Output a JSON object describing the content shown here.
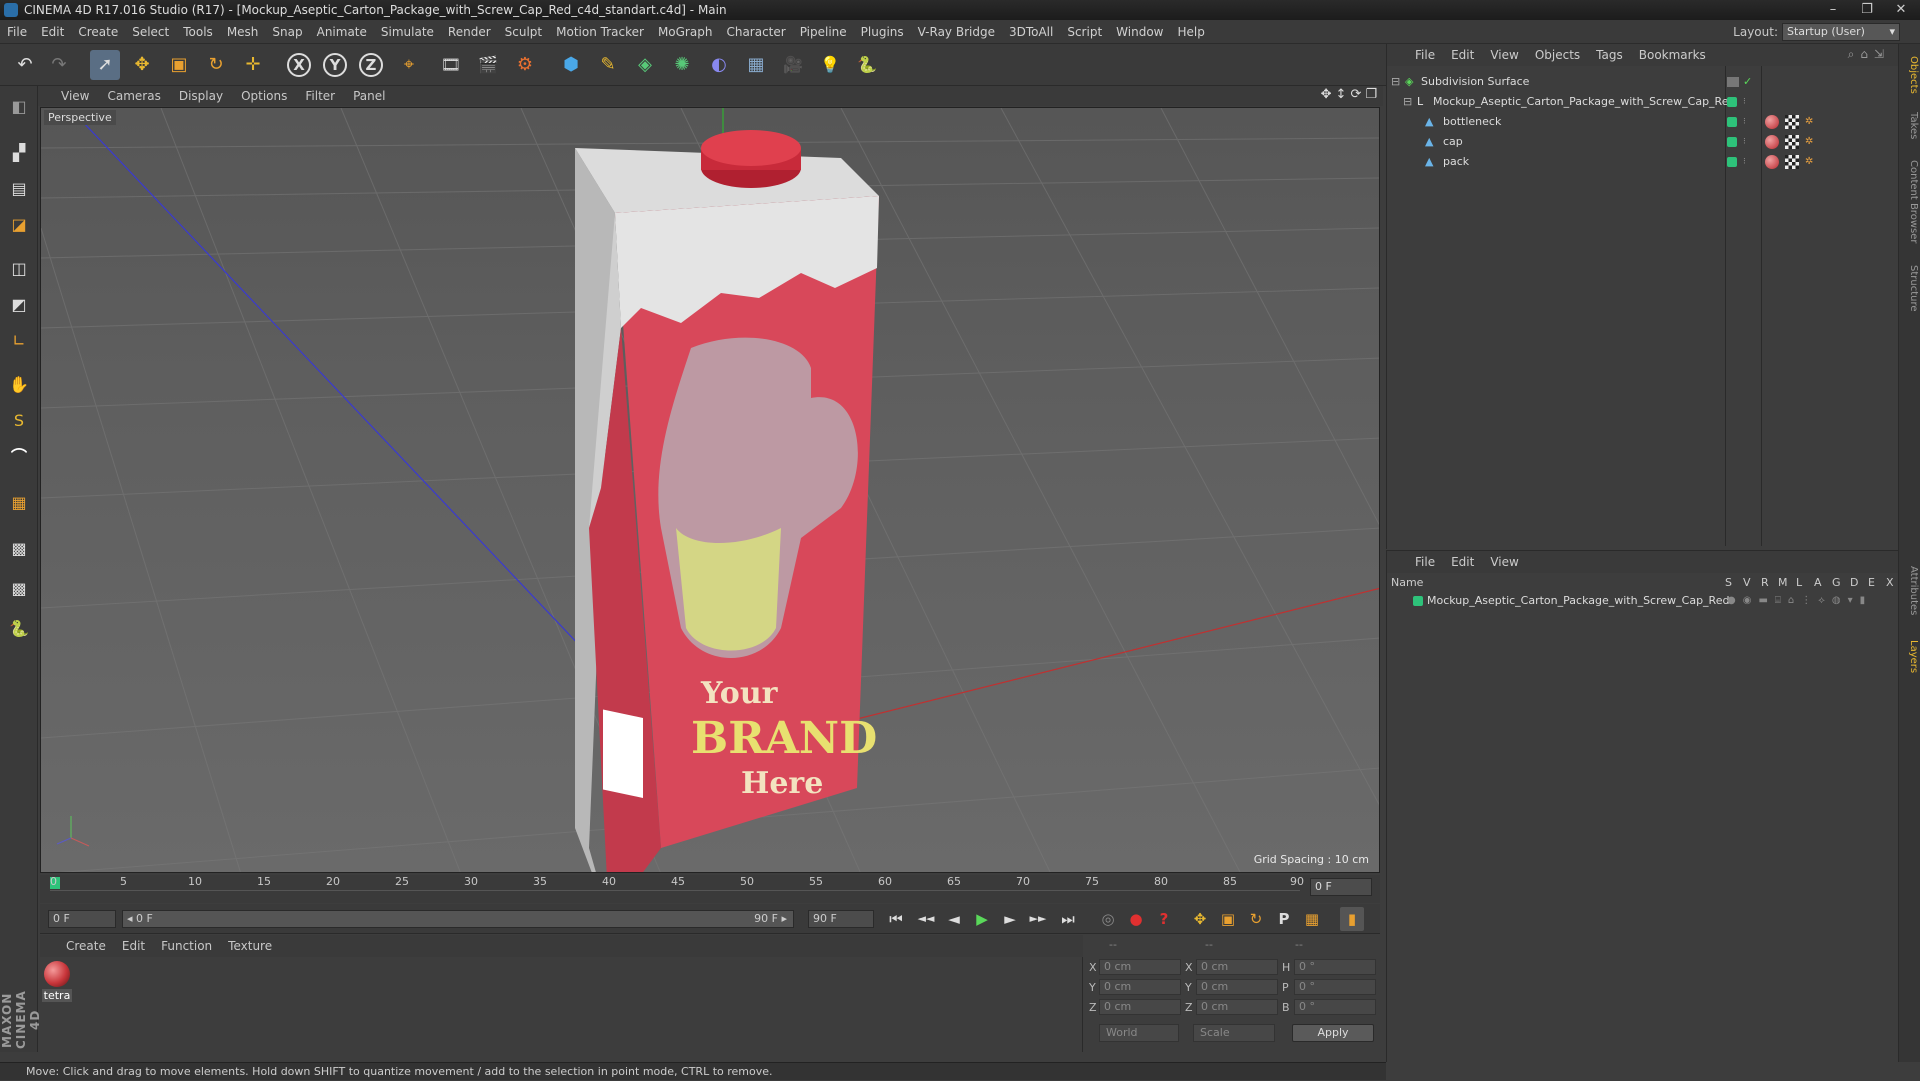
{
  "window": {
    "title": "CINEMA 4D R17.016 Studio (R17) - [Mockup_Aseptic_Carton_Package_with_Screw_Cap_Red_c4d_standart.c4d] - Main",
    "controls": [
      "–",
      "❐",
      "✕"
    ]
  },
  "menubar": {
    "items": [
      "File",
      "Edit",
      "Create",
      "Select",
      "Tools",
      "Mesh",
      "Snap",
      "Animate",
      "Simulate",
      "Render",
      "Sculpt",
      "Motion Tracker",
      "MoGraph",
      "Character",
      "Pipeline",
      "Plugins",
      "V-Ray Bridge",
      "3DToAll",
      "Script",
      "Window",
      "Help"
    ],
    "layout_label": "Layout:",
    "layout_value": "Startup (User)"
  },
  "toolbar": {
    "undo": "↶",
    "redo": "↷",
    "select": "➚",
    "move": "✥",
    "scale": "▣",
    "rotate": "↻",
    "last": "✛",
    "axis_x": "X",
    "axis_y": "Y",
    "axis_z": "Z",
    "coord": "⌖",
    "render_view": "🎞",
    "render_pic": "🎬",
    "render_settings": "⚙",
    "cube": "⬢",
    "pen": "✎",
    "subdiv": "◈",
    "cloner": "✺",
    "deformer": "◐",
    "floor": "▦",
    "camera": "🎥",
    "light": "💡",
    "python": "🐍"
  },
  "lefttools": [
    "◧",
    "▞",
    "▤",
    "◪",
    "◫",
    "◩",
    "∟",
    "✋",
    "S",
    "⌒",
    "▦",
    "▩",
    "🐍"
  ],
  "brand": "MAXON CINEMA 4D",
  "viewport": {
    "menu": [
      "View",
      "Cameras",
      "Display",
      "Options",
      "Filter",
      "Panel"
    ],
    "nav": "✥↕⟳❐",
    "label": "Perspective",
    "grid_spacing": "Grid Spacing : 10 cm",
    "pack_text": {
      "line1": "Your",
      "line2": "BRAND",
      "line3": "Here"
    }
  },
  "timeline": {
    "ticks": [
      "0",
      "5",
      "10",
      "15",
      "20",
      "25",
      "30",
      "35",
      "40",
      "45",
      "50",
      "55",
      "60",
      "65",
      "70",
      "75",
      "80",
      "85",
      "90"
    ],
    "end_frame": "0 F"
  },
  "transport": {
    "start": "0 F",
    "range_left": "◂ 0 F",
    "range_right": "90 F ▸",
    "end": "90 F",
    "buttons": [
      "⏮",
      "◄◄",
      "◄",
      "▶",
      "►",
      "►►",
      "⏭"
    ],
    "key_buttons": [
      "◎",
      "●",
      "?",
      "✥",
      "▣",
      "↻",
      "P",
      "▦",
      "▮"
    ]
  },
  "material_manager": {
    "menu": [
      "Create",
      "Edit",
      "Function",
      "Texture"
    ],
    "material_name": "tetra"
  },
  "coords": {
    "header": [
      "--",
      "--",
      "--"
    ],
    "rows": [
      {
        "l1": "X",
        "v1": "0 cm",
        "l2": "X",
        "v2": "0 cm",
        "l3": "H",
        "v3": "0 °"
      },
      {
        "l1": "Y",
        "v1": "0 cm",
        "l2": "Y",
        "v2": "0 cm",
        "l3": "P",
        "v3": "0 °"
      },
      {
        "l1": "Z",
        "v1": "0 cm",
        "l2": "Z",
        "v2": "0 cm",
        "l3": "B",
        "v3": "0 °"
      }
    ],
    "world": "World",
    "scale": "Scale",
    "apply": "Apply"
  },
  "status": "Move: Click and drag to move elements. Hold down SHIFT to quantize movement / add to the selection in point mode, CTRL to remove.",
  "object_manager": {
    "menu": [
      "File",
      "Edit",
      "View",
      "Objects",
      "Tags",
      "Bookmarks"
    ],
    "objects": [
      {
        "name": "Subdivision Surface",
        "indent": 0
      },
      {
        "name": "Mockup_Aseptic_Carton_Package_with_Screw_Cap_Red",
        "indent": 1
      },
      {
        "name": "bottleneck",
        "indent": 2
      },
      {
        "name": "cap",
        "indent": 2
      },
      {
        "name": "pack",
        "indent": 2
      }
    ]
  },
  "layer_manager": {
    "menu": [
      "File",
      "Edit",
      "View"
    ],
    "name_header": "Name",
    "cols": [
      "S",
      "V",
      "R",
      "M",
      "L",
      "A",
      "G",
      "D",
      "E",
      "X"
    ],
    "layers": [
      {
        "name": "Mockup_Aseptic_Carton_Package_with_Screw_Cap_Red"
      }
    ]
  },
  "right_tabs": [
    "Objects",
    "Takes",
    "Content Browser",
    "Structure",
    "Attributes",
    "Layers"
  ],
  "colors": {
    "accent": "#5a6e84",
    "layer_green": "#2ec27a",
    "pack_red": "#d8485a"
  }
}
